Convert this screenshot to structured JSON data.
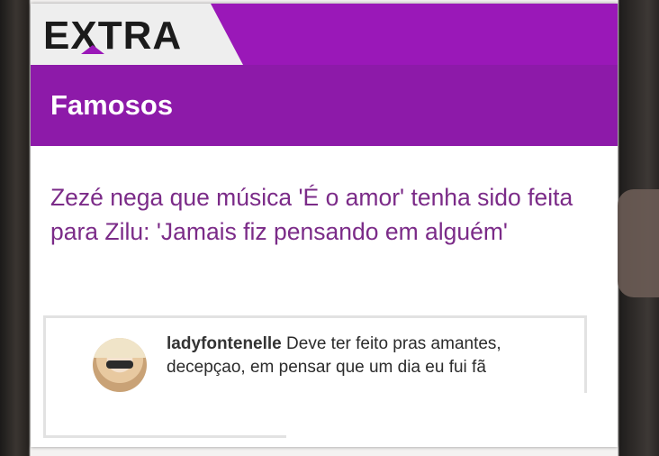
{
  "header": {
    "logo_text": "EXTRA",
    "brand_color": "#9a18b8"
  },
  "section": {
    "title": "Famosos",
    "color": "#8d1aa9"
  },
  "article": {
    "headline": "Zezé nega que música 'É o amor' tenha sido feita para Zilu: 'Jamais fiz pensando em alguém'",
    "headline_color": "#7b2b88"
  },
  "comment": {
    "username": "ladyfontenelle",
    "text": "Deve ter feito pras amantes, decepçao, em pensar que um dia eu fui fã",
    "avatar_icon": "user-avatar"
  }
}
